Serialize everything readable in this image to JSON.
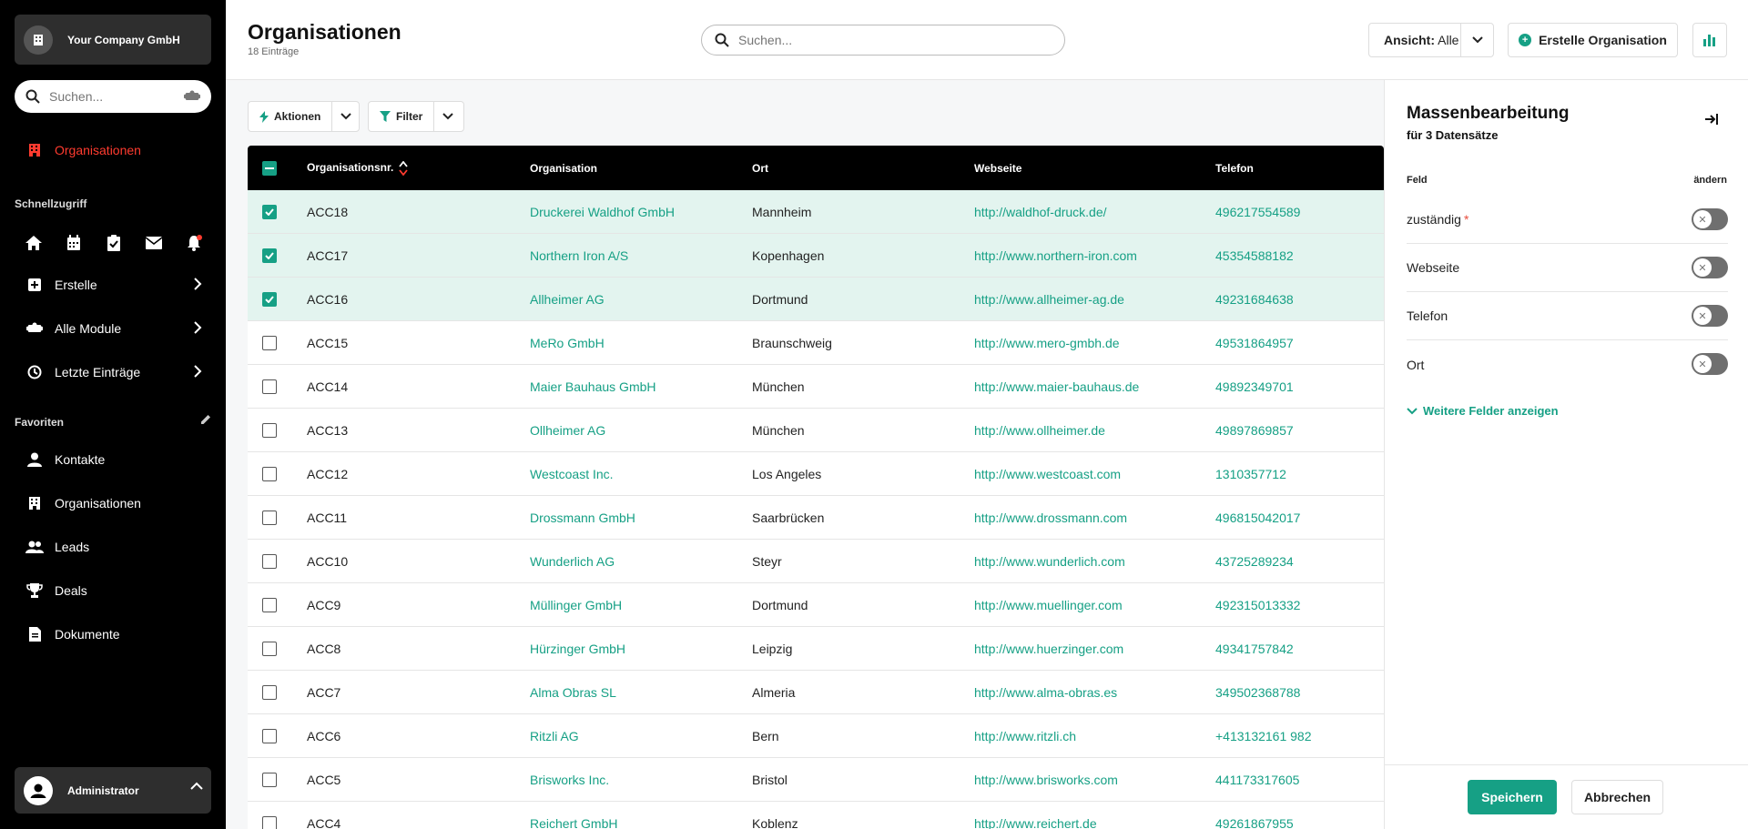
{
  "sidebar": {
    "company": "Your Company GmbH",
    "search_placeholder": "Suchen...",
    "active_item": "Organisationen",
    "quick_access_label": "Schnellzugriff",
    "menu": [
      {
        "label": "Erstelle"
      },
      {
        "label": "Alle Module"
      },
      {
        "label": "Letzte Einträge"
      }
    ],
    "favorites_label": "Favoriten",
    "favorites": [
      {
        "label": "Kontakte"
      },
      {
        "label": "Organisationen"
      },
      {
        "label": "Leads"
      },
      {
        "label": "Deals"
      },
      {
        "label": "Dokumente"
      }
    ],
    "user": "Administrator"
  },
  "header": {
    "title": "Organisationen",
    "count": "18 Einträge",
    "search_placeholder": "Suchen...",
    "view_label": "Ansicht:",
    "view_value": "Alle",
    "create_label": "Erstelle Organisation"
  },
  "toolbar": {
    "actions_label": "Aktionen",
    "filter_label": "Filter"
  },
  "table": {
    "columns": [
      "Organisationsnr.",
      "Organisation",
      "Ort",
      "Webseite",
      "Telefon"
    ],
    "rows": [
      {
        "nr": "ACC18",
        "org": "Druckerei Waldhof GmbH",
        "ort": "Mannheim",
        "web": "http://waldhof-druck.de/",
        "tel": "496217554589",
        "selected": true
      },
      {
        "nr": "ACC17",
        "org": "Northern Iron A/S",
        "ort": "Kopenhagen",
        "web": "http://www.northern-iron.com",
        "tel": "45354588182",
        "selected": true
      },
      {
        "nr": "ACC16",
        "org": "Allheimer AG",
        "ort": "Dortmund",
        "web": "http://www.allheimer-ag.de",
        "tel": "49231684638",
        "selected": true
      },
      {
        "nr": "ACC15",
        "org": "MeRo GmbH",
        "ort": "Braunschweig",
        "web": "http://www.mero-gmbh.de",
        "tel": "49531864957",
        "selected": false
      },
      {
        "nr": "ACC14",
        "org": "Maier Bauhaus GmbH",
        "ort": "München",
        "web": "http://www.maier-bauhaus.de",
        "tel": "49892349701",
        "selected": false
      },
      {
        "nr": "ACC13",
        "org": "Ollheimer AG",
        "ort": "München",
        "web": "http://www.ollheimer.de",
        "tel": "49897869857",
        "selected": false
      },
      {
        "nr": "ACC12",
        "org": "Westcoast Inc.",
        "ort": "Los Angeles",
        "web": "http://www.westcoast.com",
        "tel": "1310357712",
        "selected": false
      },
      {
        "nr": "ACC11",
        "org": "Drossmann GmbH",
        "ort": "Saarbrücken",
        "web": "http://www.drossmann.com",
        "tel": "496815042017",
        "selected": false
      },
      {
        "nr": "ACC10",
        "org": "Wunderlich AG",
        "ort": "Steyr",
        "web": "http://www.wunderlich.com",
        "tel": "43725289234",
        "selected": false
      },
      {
        "nr": "ACC9",
        "org": "Müllinger GmbH",
        "ort": "Dortmund",
        "web": "http://www.muellinger.com",
        "tel": "492315013332",
        "selected": false
      },
      {
        "nr": "ACC8",
        "org": "Hürzinger GmbH",
        "ort": "Leipzig",
        "web": "http://www.huerzinger.com",
        "tel": "49341757842",
        "selected": false
      },
      {
        "nr": "ACC7",
        "org": "Alma Obras SL",
        "ort": "Almeria",
        "web": "http://www.alma-obras.es",
        "tel": "349502368788",
        "selected": false
      },
      {
        "nr": "ACC6",
        "org": "Ritzli AG",
        "ort": "Bern",
        "web": "http://www.ritzli.ch",
        "tel": "+413132161 982",
        "selected": false
      },
      {
        "nr": "ACC5",
        "org": "Brisworks Inc.",
        "ort": "Bristol",
        "web": "http://www.brisworks.com",
        "tel": "441173317605",
        "selected": false
      },
      {
        "nr": "ACC4",
        "org": "Reichert GmbH",
        "ort": "Koblenz",
        "web": "http://www.reichert.de",
        "tel": "49261867955",
        "selected": false
      }
    ]
  },
  "panel": {
    "title": "Massenbearbeitung",
    "subtitle": "für 3 Datensätze",
    "col_field": "Feld",
    "col_change": "ändern",
    "fields": [
      {
        "label": "zuständig",
        "required": true
      },
      {
        "label": "Webseite",
        "required": false
      },
      {
        "label": "Telefon",
        "required": false
      },
      {
        "label": "Ort",
        "required": false
      }
    ],
    "required_mark": "*",
    "more_label": "Weitere Felder anzeigen",
    "save_label": "Speichern",
    "cancel_label": "Abbrechen"
  },
  "colors": {
    "accent": "#16a085",
    "active_nav": "#ff3b2f",
    "selected_row": "#e3f4ef"
  }
}
